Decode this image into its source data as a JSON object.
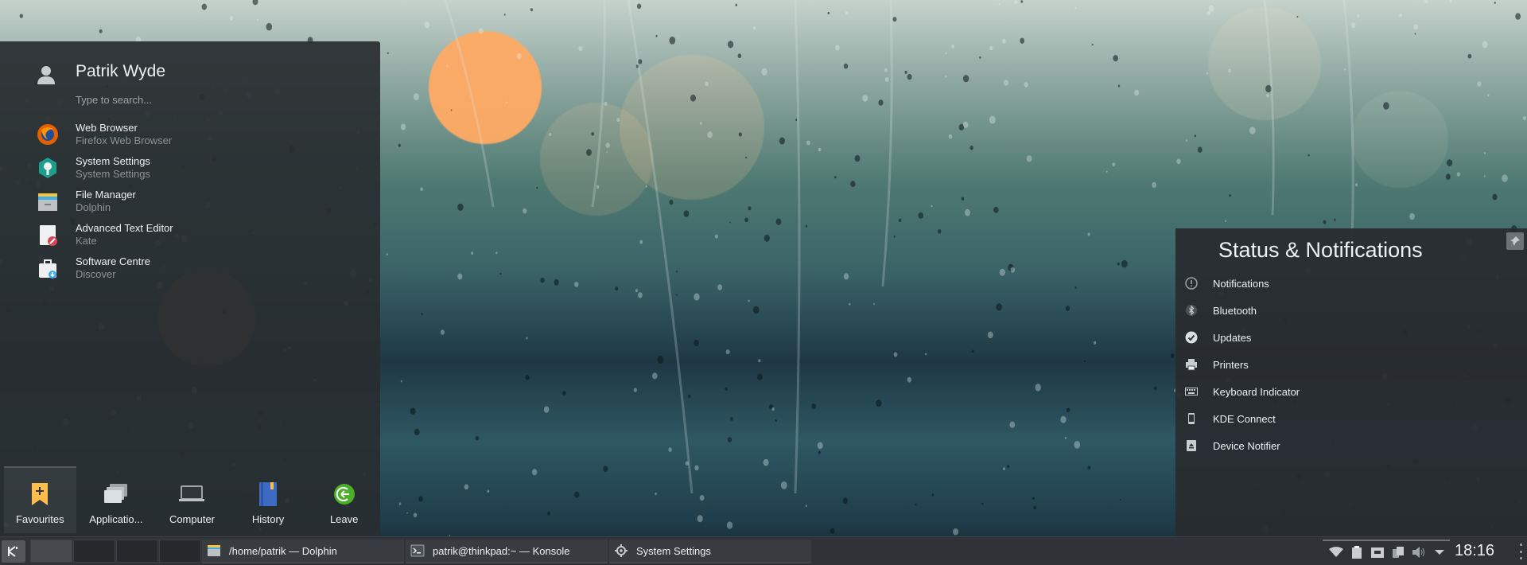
{
  "user": {
    "name": "Patrik Wyde",
    "avatar_icon": "user-avatar-icon"
  },
  "search": {
    "placeholder": "Type to search..."
  },
  "favourites": [
    {
      "name": "Web Browser",
      "subtitle": "Firefox Web Browser",
      "icon": "firefox-icon"
    },
    {
      "name": "System Settings",
      "subtitle": "System Settings",
      "icon": "system-settings-icon"
    },
    {
      "name": "File Manager",
      "subtitle": "Dolphin",
      "icon": "folder-icon"
    },
    {
      "name": "Advanced Text Editor",
      "subtitle": "Kate",
      "icon": "text-editor-icon"
    },
    {
      "name": "Software Centre",
      "subtitle": "Discover",
      "icon": "software-centre-icon"
    }
  ],
  "launcher_tabs": [
    {
      "label": "Favourites",
      "icon": "bookmark-icon",
      "active": true
    },
    {
      "label": "Applicatio...",
      "icon": "applications-icon",
      "active": false
    },
    {
      "label": "Computer",
      "icon": "computer-icon",
      "active": false
    },
    {
      "label": "History",
      "icon": "history-icon",
      "active": false
    },
    {
      "label": "Leave",
      "icon": "leave-icon",
      "active": false
    }
  ],
  "notifications_panel": {
    "title": "Status & Notifications",
    "items": [
      {
        "label": "Notifications",
        "icon": "notifications-icon"
      },
      {
        "label": "Bluetooth",
        "icon": "bluetooth-icon"
      },
      {
        "label": "Updates",
        "icon": "updates-icon"
      },
      {
        "label": "Printers",
        "icon": "printer-icon"
      },
      {
        "label": "Keyboard Indicator",
        "icon": "keyboard-icon"
      },
      {
        "label": "KDE Connect",
        "icon": "phone-icon"
      },
      {
        "label": "Device Notifier",
        "icon": "device-notifier-icon"
      }
    ]
  },
  "taskbar": {
    "tasks": [
      {
        "label": "/home/patrik — Dolphin",
        "icon": "folder-icon"
      },
      {
        "label": "patrik@thinkpad:~ — Konsole",
        "icon": "terminal-icon"
      },
      {
        "label": "System Settings",
        "icon": "system-settings-icon"
      }
    ],
    "clock": "18:16"
  },
  "colors": {
    "accent": "#3daee9",
    "panel_bg": "#2f3337",
    "firefox": "#e66000",
    "leave": "#4caf2a",
    "bookmark": "#fdbc4b"
  }
}
